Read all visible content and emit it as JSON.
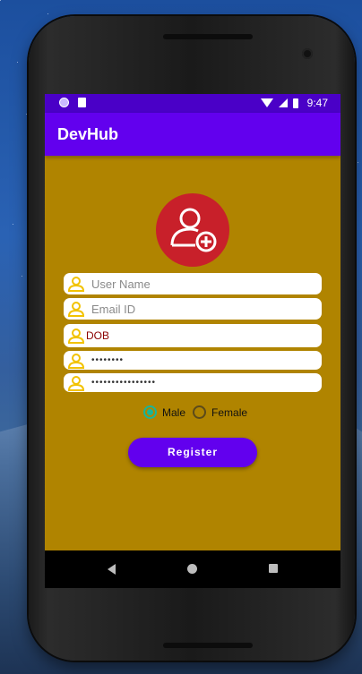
{
  "status_bar": {
    "time": "9:47"
  },
  "app_bar": {
    "title": "DevHub"
  },
  "form": {
    "username": {
      "placeholder": "User Name"
    },
    "email": {
      "placeholder": "Email ID"
    },
    "dob": {
      "value": "DOB"
    },
    "password": {
      "value": "••••••••"
    },
    "confirm_password": {
      "value": "••••••••••••••••"
    }
  },
  "gender": {
    "options": [
      {
        "label": "Male",
        "selected": true
      },
      {
        "label": "Female",
        "selected": false
      }
    ]
  },
  "register_button": {
    "label": "Register"
  },
  "colors": {
    "background": "#b08400",
    "primary": "#6200ee",
    "avatar": "#c8202a",
    "icon": "#f2c200",
    "radio_selected": "#18b59a"
  },
  "icons": {
    "avatar": "add-user-icon",
    "field": "person-outline-icon"
  }
}
